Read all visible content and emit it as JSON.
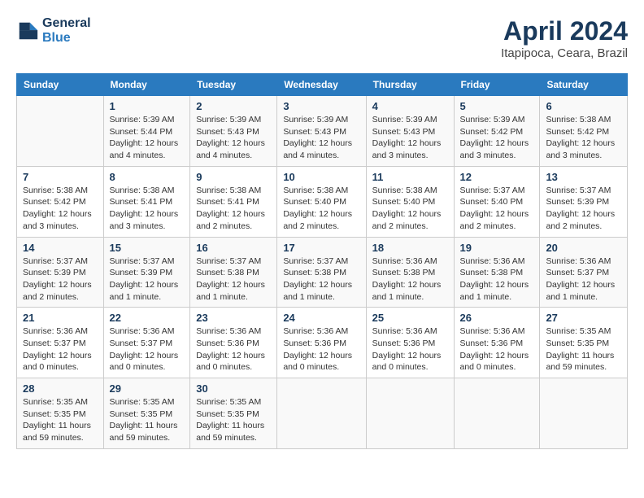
{
  "header": {
    "logo_line1": "General",
    "logo_line2": "Blue",
    "month_title": "April 2024",
    "subtitle": "Itapipoca, Ceara, Brazil"
  },
  "columns": [
    "Sunday",
    "Monday",
    "Tuesday",
    "Wednesday",
    "Thursday",
    "Friday",
    "Saturday"
  ],
  "weeks": [
    [
      {
        "day": "",
        "info": ""
      },
      {
        "day": "1",
        "info": "Sunrise: 5:39 AM\nSunset: 5:44 PM\nDaylight: 12 hours\nand 4 minutes."
      },
      {
        "day": "2",
        "info": "Sunrise: 5:39 AM\nSunset: 5:43 PM\nDaylight: 12 hours\nand 4 minutes."
      },
      {
        "day": "3",
        "info": "Sunrise: 5:39 AM\nSunset: 5:43 PM\nDaylight: 12 hours\nand 4 minutes."
      },
      {
        "day": "4",
        "info": "Sunrise: 5:39 AM\nSunset: 5:43 PM\nDaylight: 12 hours\nand 3 minutes."
      },
      {
        "day": "5",
        "info": "Sunrise: 5:39 AM\nSunset: 5:42 PM\nDaylight: 12 hours\nand 3 minutes."
      },
      {
        "day": "6",
        "info": "Sunrise: 5:38 AM\nSunset: 5:42 PM\nDaylight: 12 hours\nand 3 minutes."
      }
    ],
    [
      {
        "day": "7",
        "info": "Sunrise: 5:38 AM\nSunset: 5:42 PM\nDaylight: 12 hours\nand 3 minutes."
      },
      {
        "day": "8",
        "info": "Sunrise: 5:38 AM\nSunset: 5:41 PM\nDaylight: 12 hours\nand 3 minutes."
      },
      {
        "day": "9",
        "info": "Sunrise: 5:38 AM\nSunset: 5:41 PM\nDaylight: 12 hours\nand 2 minutes."
      },
      {
        "day": "10",
        "info": "Sunrise: 5:38 AM\nSunset: 5:40 PM\nDaylight: 12 hours\nand 2 minutes."
      },
      {
        "day": "11",
        "info": "Sunrise: 5:38 AM\nSunset: 5:40 PM\nDaylight: 12 hours\nand 2 minutes."
      },
      {
        "day": "12",
        "info": "Sunrise: 5:37 AM\nSunset: 5:40 PM\nDaylight: 12 hours\nand 2 minutes."
      },
      {
        "day": "13",
        "info": "Sunrise: 5:37 AM\nSunset: 5:39 PM\nDaylight: 12 hours\nand 2 minutes."
      }
    ],
    [
      {
        "day": "14",
        "info": "Sunrise: 5:37 AM\nSunset: 5:39 PM\nDaylight: 12 hours\nand 2 minutes."
      },
      {
        "day": "15",
        "info": "Sunrise: 5:37 AM\nSunset: 5:39 PM\nDaylight: 12 hours\nand 1 minute."
      },
      {
        "day": "16",
        "info": "Sunrise: 5:37 AM\nSunset: 5:38 PM\nDaylight: 12 hours\nand 1 minute."
      },
      {
        "day": "17",
        "info": "Sunrise: 5:37 AM\nSunset: 5:38 PM\nDaylight: 12 hours\nand 1 minute."
      },
      {
        "day": "18",
        "info": "Sunrise: 5:36 AM\nSunset: 5:38 PM\nDaylight: 12 hours\nand 1 minute."
      },
      {
        "day": "19",
        "info": "Sunrise: 5:36 AM\nSunset: 5:38 PM\nDaylight: 12 hours\nand 1 minute."
      },
      {
        "day": "20",
        "info": "Sunrise: 5:36 AM\nSunset: 5:37 PM\nDaylight: 12 hours\nand 1 minute."
      }
    ],
    [
      {
        "day": "21",
        "info": "Sunrise: 5:36 AM\nSunset: 5:37 PM\nDaylight: 12 hours\nand 0 minutes."
      },
      {
        "day": "22",
        "info": "Sunrise: 5:36 AM\nSunset: 5:37 PM\nDaylight: 12 hours\nand 0 minutes."
      },
      {
        "day": "23",
        "info": "Sunrise: 5:36 AM\nSunset: 5:36 PM\nDaylight: 12 hours\nand 0 minutes."
      },
      {
        "day": "24",
        "info": "Sunrise: 5:36 AM\nSunset: 5:36 PM\nDaylight: 12 hours\nand 0 minutes."
      },
      {
        "day": "25",
        "info": "Sunrise: 5:36 AM\nSunset: 5:36 PM\nDaylight: 12 hours\nand 0 minutes."
      },
      {
        "day": "26",
        "info": "Sunrise: 5:36 AM\nSunset: 5:36 PM\nDaylight: 12 hours\nand 0 minutes."
      },
      {
        "day": "27",
        "info": "Sunrise: 5:35 AM\nSunset: 5:35 PM\nDaylight: 11 hours\nand 59 minutes."
      }
    ],
    [
      {
        "day": "28",
        "info": "Sunrise: 5:35 AM\nSunset: 5:35 PM\nDaylight: 11 hours\nand 59 minutes."
      },
      {
        "day": "29",
        "info": "Sunrise: 5:35 AM\nSunset: 5:35 PM\nDaylight: 11 hours\nand 59 minutes."
      },
      {
        "day": "30",
        "info": "Sunrise: 5:35 AM\nSunset: 5:35 PM\nDaylight: 11 hours\nand 59 minutes."
      },
      {
        "day": "",
        "info": ""
      },
      {
        "day": "",
        "info": ""
      },
      {
        "day": "",
        "info": ""
      },
      {
        "day": "",
        "info": ""
      }
    ]
  ]
}
